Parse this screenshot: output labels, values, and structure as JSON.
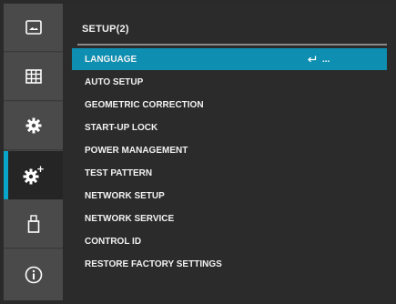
{
  "header": {
    "title": "SETUP(2)"
  },
  "sidebar": {
    "items": [
      {
        "icon": "picture-icon"
      },
      {
        "icon": "grid-icon"
      },
      {
        "icon": "gear-icon"
      },
      {
        "icon": "gear-plus-icon"
      },
      {
        "icon": "usb-icon"
      },
      {
        "icon": "info-icon"
      }
    ]
  },
  "menu": {
    "items": [
      {
        "label": "LANGUAGE",
        "extra_icon": "enter-icon",
        "extra_text": "..."
      },
      {
        "label": "AUTO SETUP"
      },
      {
        "label": "GEOMETRIC CORRECTION"
      },
      {
        "label": "START-UP LOCK"
      },
      {
        "label": "POWER MANAGEMENT"
      },
      {
        "label": "TEST PATTERN"
      },
      {
        "label": "NETWORK SETUP"
      },
      {
        "label": "NETWORK SERVICE"
      },
      {
        "label": "CONTROL ID"
      },
      {
        "label": "RESTORE FACTORY SETTINGS"
      }
    ]
  },
  "colors": {
    "accent": "#0aa6c9",
    "selected_row": "#0e8fb2"
  }
}
